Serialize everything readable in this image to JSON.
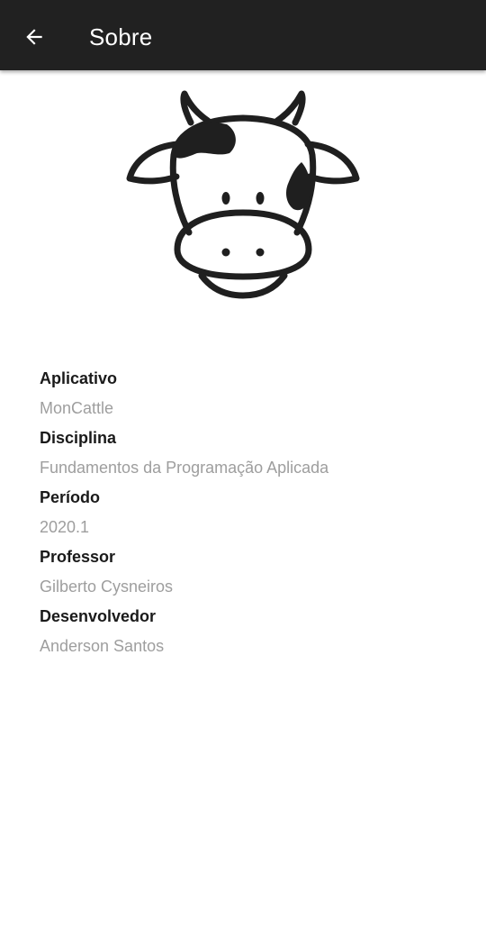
{
  "appbar": {
    "title": "Sobre",
    "back_icon": "arrow-left-icon"
  },
  "logo": {
    "icon": "cow-head-icon"
  },
  "info": {
    "items": [
      {
        "label": "Aplicativo",
        "value": "MonCattle"
      },
      {
        "label": "Disciplina",
        "value": "Fundamentos da Programação Aplicada"
      },
      {
        "label": "Período",
        "value": "2020.1"
      },
      {
        "label": "Professor",
        "value": "Gilberto Cysneiros"
      },
      {
        "label": "Desenvolvedor",
        "value": "Anderson Santos"
      }
    ]
  },
  "colors": {
    "appbar_bg": "#212121",
    "label": "#1a1a1a",
    "value": "#9e9e9e"
  }
}
